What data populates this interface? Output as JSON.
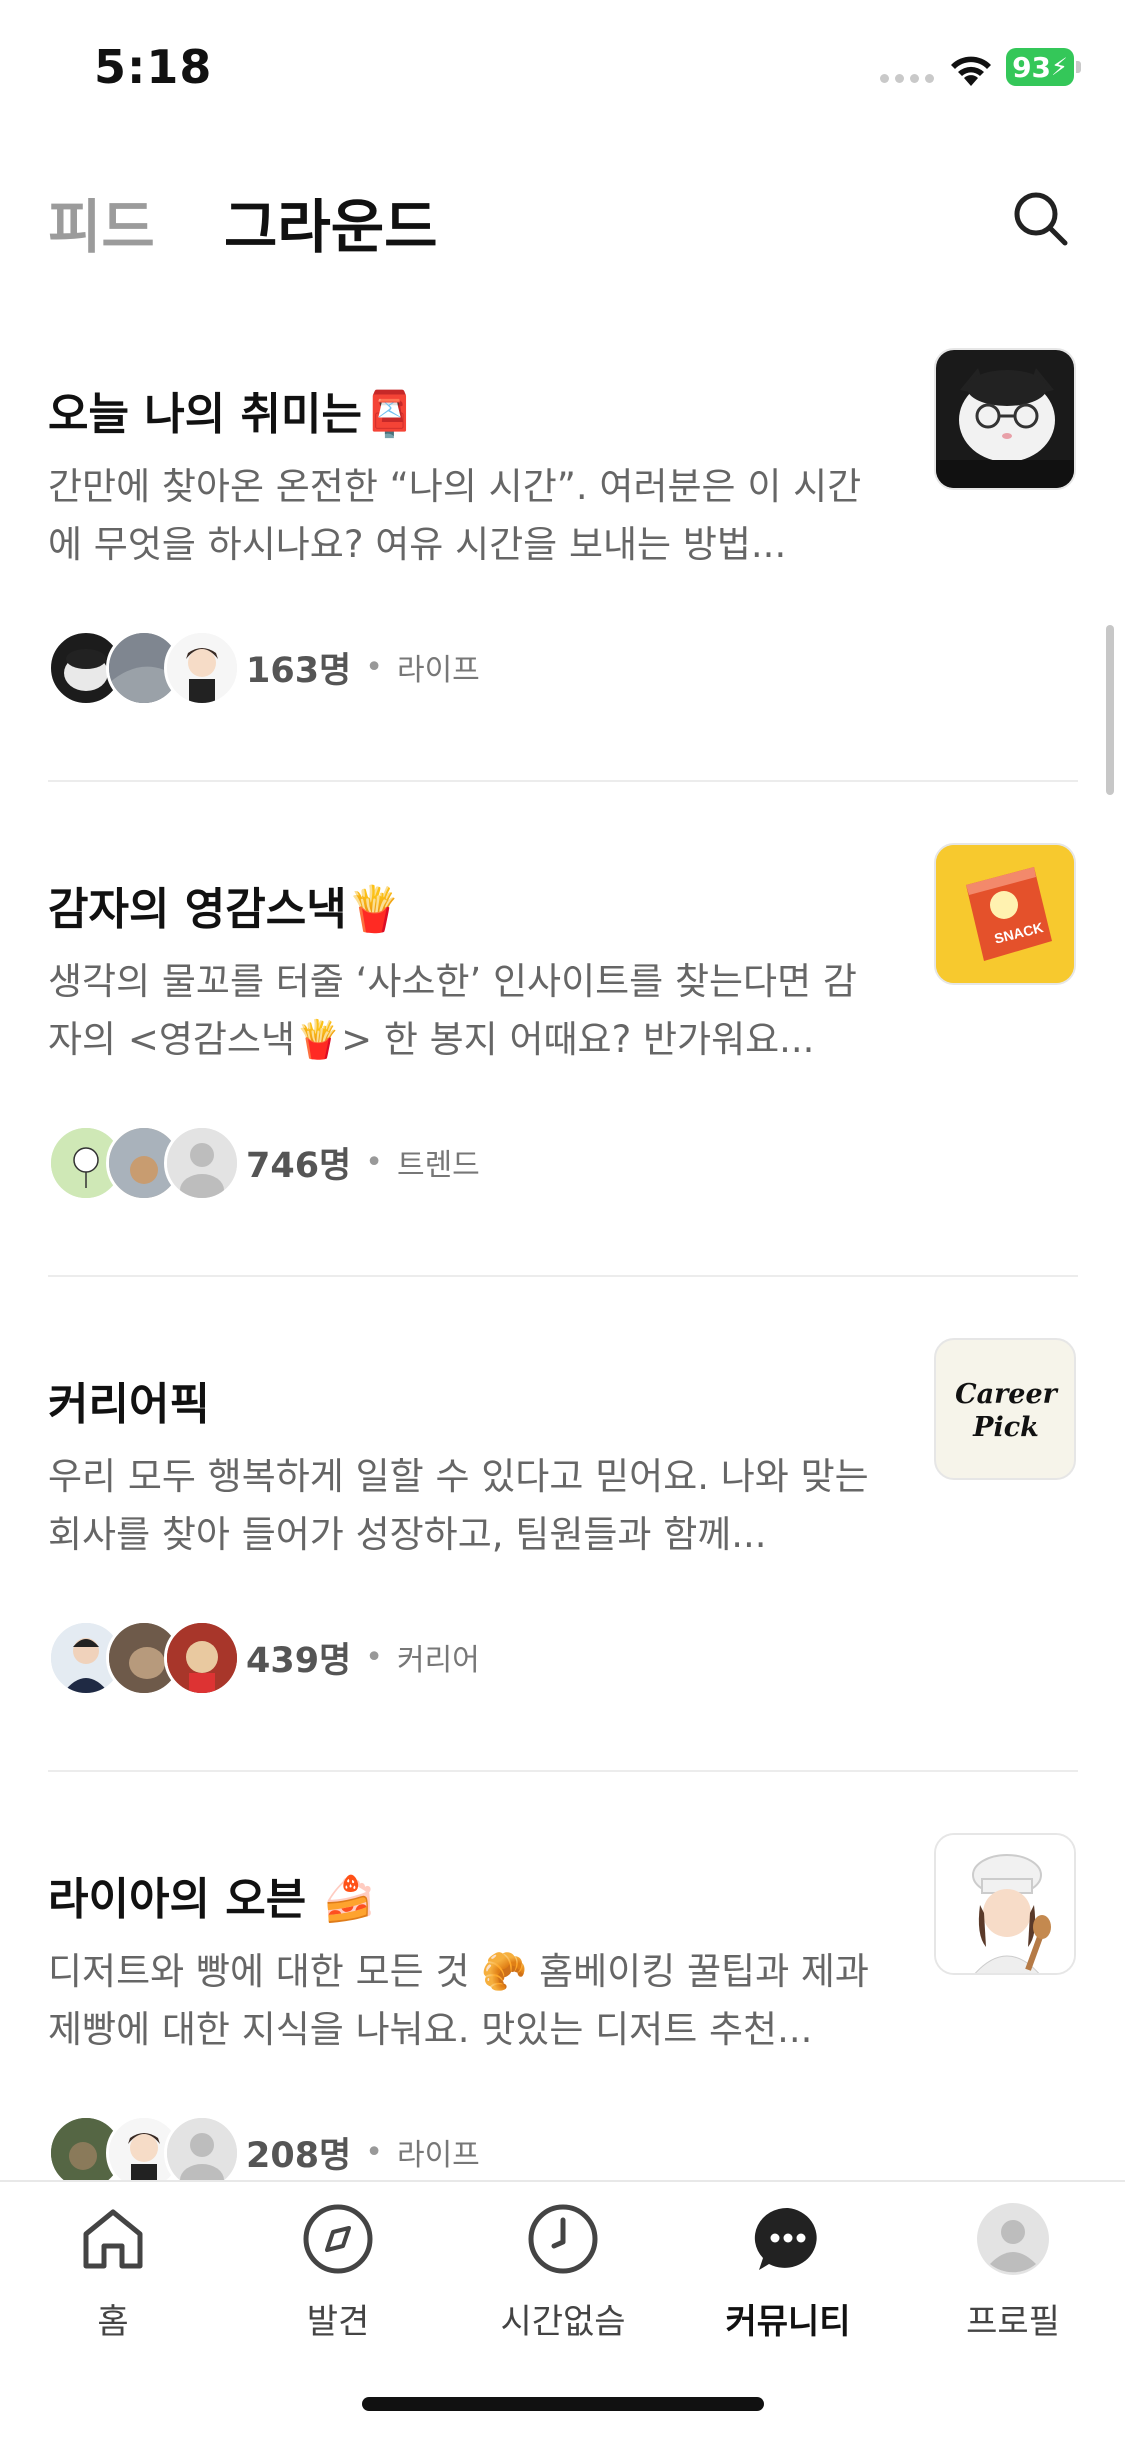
{
  "status_bar": {
    "time": "5:18",
    "battery": "93"
  },
  "header": {
    "tabs": [
      {
        "label": "피드"
      },
      {
        "label": "그라운드"
      }
    ]
  },
  "cards": [
    {
      "title": "오늘 나의 취미는📮",
      "desc": "간만에 찾아온 온전한 “나의 시간”. 여러분은 이 시간에 무엇을 하시나요? 여유 시간을 보내는 방법...",
      "count": "163명",
      "category": "라이프"
    },
    {
      "title": "감자의 영감스낵🍟",
      "desc": "생각의 물꼬를 터줄 ‘사소한’ 인사이트를 찾는다면 감자의 <영감스낵🍟> 한 봉지 어때요? 반가워요...",
      "count": "746명",
      "category": "트렌드",
      "thumb_text": "SNACK"
    },
    {
      "title": "커리어픽",
      "desc": "우리 모두 행복하게 일할 수 있다고 믿어요. 나와 맞는 회사를 찾아 들어가 성장하고, 팀원들과 함께...",
      "count": "439명",
      "category": "커리어",
      "thumb_text_1": "Career",
      "thumb_text_2": "Pick"
    },
    {
      "title": "라이아의 오븐 🍰",
      "desc": "디저트와 빵에 대한 모든 것 🥐 홈베이킹 꿀팁과 제과제빵에 대한 지식을 나눠요. 맛있는 디저트 추천...",
      "count": "208명",
      "category": "라이프"
    }
  ],
  "dot": "•",
  "nav": [
    {
      "label": "홈",
      "icon": "home-icon"
    },
    {
      "label": "발견",
      "icon": "compass-icon"
    },
    {
      "label": "시간없슴",
      "icon": "clock-icon"
    },
    {
      "label": "커뮤니티",
      "icon": "chat-bubble-icon",
      "active": true
    },
    {
      "label": "프로필",
      "icon": "profile-icon"
    }
  ],
  "colors": {
    "battery": "#34c759",
    "snack_bg": "#f7c92e",
    "career_bg": "#f6f4ea",
    "text_muted": "#666666"
  }
}
